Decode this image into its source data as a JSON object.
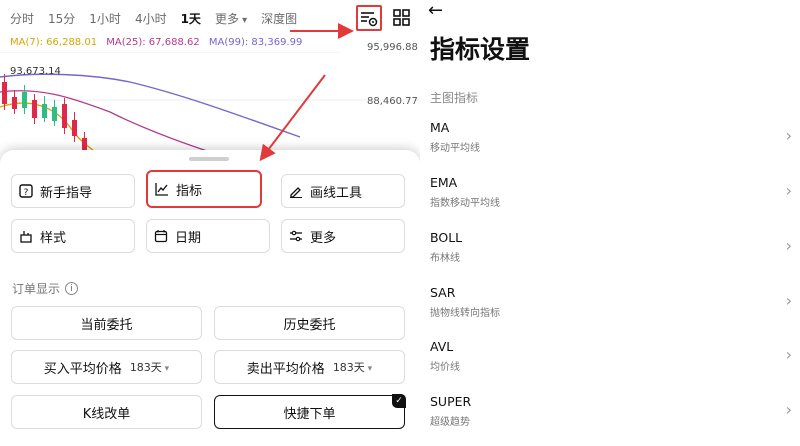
{
  "timeframes": [
    {
      "label": "分时",
      "active": false
    },
    {
      "label": "15分",
      "active": false
    },
    {
      "label": "1小时",
      "active": false
    },
    {
      "label": "4小时",
      "active": false
    },
    {
      "label": "1天",
      "active": true
    },
    {
      "label": "更多",
      "active": false
    },
    {
      "label": "深度图",
      "active": false
    }
  ],
  "ma": {
    "ma7": "MA(7): 66,288.01",
    "ma25": "MA(25): 67,688.62",
    "ma99": "MA(99): 83,369.99"
  },
  "prices": {
    "p1": "95,996.88",
    "p2": "93,673.14",
    "p3": "88,460.77"
  },
  "tools": {
    "newbie_guide": "新手指导",
    "indicators": "指标",
    "drawing_tools": "画线工具",
    "style": "样式",
    "date": "日期",
    "more": "更多"
  },
  "orders": {
    "section_label": "订单显示",
    "current_orders": "当前委托",
    "history_orders": "历史委托",
    "buy_avg_price": "买入平均价格",
    "buy_days": "183天",
    "sell_avg_price": "卖出平均价格",
    "sell_days": "183天",
    "kline_modify": "K线改单",
    "quick_order": "快捷下单"
  },
  "indicator_settings": {
    "title": "指标设置",
    "group_label": "主图指标",
    "items": [
      {
        "name": "MA",
        "desc": "移动平均线"
      },
      {
        "name": "EMA",
        "desc": "指数移动平均线"
      },
      {
        "name": "BOLL",
        "desc": "布林线"
      },
      {
        "name": "SAR",
        "desc": "抛物线转向指标"
      },
      {
        "name": "AVL",
        "desc": "均价线"
      },
      {
        "name": "SUPER",
        "desc": "超级趋势"
      }
    ]
  },
  "colors": {
    "highlight_red": "#e23a3a",
    "candle_up": "#2ebd85",
    "candle_down": "#e0294a",
    "ma7": "#d9a400",
    "ma25": "#b43a8e",
    "ma99": "#7a63c9"
  },
  "icons": {
    "back": "arrow-left-icon",
    "indicator_settings": "indicator-settings-icon",
    "grid": "grid-icon"
  }
}
